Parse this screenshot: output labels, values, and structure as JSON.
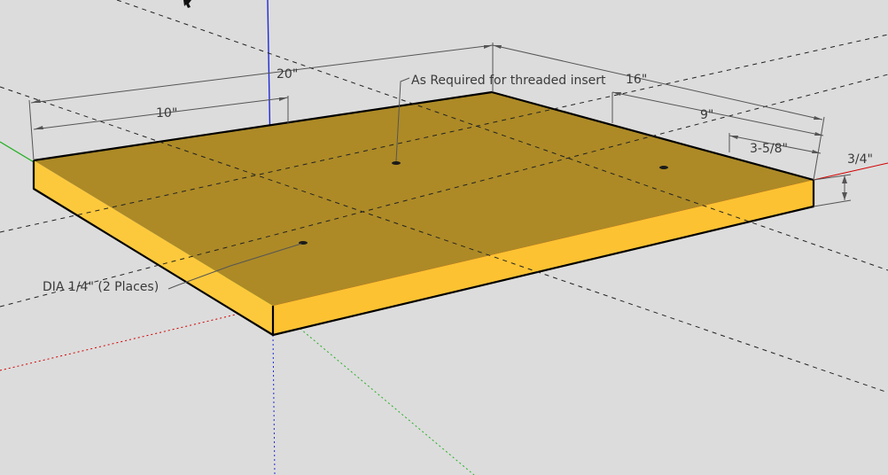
{
  "colors": {
    "background": "#dcdcdc",
    "board_top": "#ad8a26",
    "board_front_face": "#fdc93c",
    "board_side_face": "#fcc232",
    "axis_red": "#d40000",
    "axis_green": "#22b022",
    "axis_blue": "#1f2ad6",
    "dimension_text": "#3a3a3a"
  },
  "dimensions": {
    "overall_length": "20\"",
    "half_length": "10\"",
    "overall_width": "16\"",
    "width_to_hole": "9\"",
    "edge_to_hole": "3-5/8\"",
    "thickness": "3/4\""
  },
  "annotations": {
    "threaded_insert": "As Required for threaded insert",
    "hole_diameter": "DIA 1/4\" (2 Places)"
  },
  "icons": {
    "cursor": "arrow-cursor-icon"
  }
}
